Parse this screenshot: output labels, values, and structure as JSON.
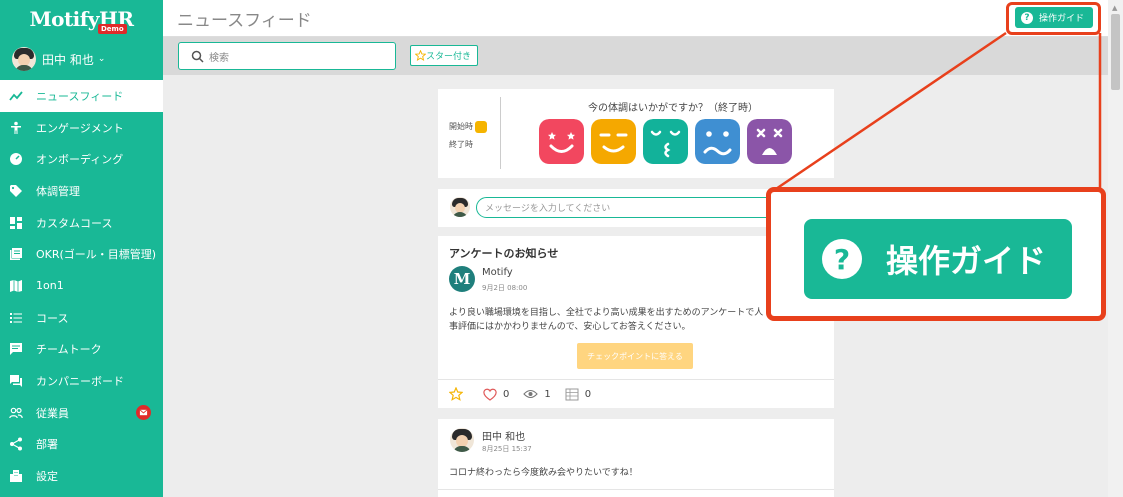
{
  "app": {
    "logo": "MotifyHR",
    "badge": "Demo"
  },
  "user": {
    "name": "田中 和也"
  },
  "sidebar": {
    "items": [
      {
        "label": "ニュースフィード",
        "icon": "trend-icon",
        "active": true
      },
      {
        "label": "エンゲージメント",
        "icon": "person-icon"
      },
      {
        "label": "オンボーディング",
        "icon": "gauge-icon"
      },
      {
        "label": "体調管理",
        "icon": "tag-icon"
      },
      {
        "label": "カスタムコース",
        "icon": "dashboard-icon"
      },
      {
        "label": "OKR(ゴール・目標管理)",
        "icon": "book-icon"
      },
      {
        "label": "1on1",
        "icon": "map-icon"
      },
      {
        "label": "コース",
        "icon": "list-icon"
      },
      {
        "label": "チームトーク",
        "icon": "chat-icon"
      },
      {
        "label": "カンパニーボード",
        "icon": "forum-icon"
      },
      {
        "label": "従業員",
        "icon": "people-icon",
        "badge": "mail-icon"
      },
      {
        "label": "部署",
        "icon": "share-icon"
      },
      {
        "label": "設定",
        "icon": "building-icon"
      }
    ]
  },
  "header": {
    "title": "ニュースフィード",
    "guide_label": "操作ガイド"
  },
  "search": {
    "placeholder": "検索",
    "star_filter": "スター付き"
  },
  "mood": {
    "question": "今の体調はいかがですか？（終了時）",
    "start_label": "開始時",
    "end_label": "終了時",
    "colors": [
      "#f2475f",
      "#f5a800",
      "#12b29a",
      "#3f8fd2",
      "#8b55a8"
    ]
  },
  "message": {
    "placeholder": "メッセージを入力してください"
  },
  "post": {
    "title": "アンケートのお知らせ",
    "author": "Motify",
    "date": "9月2日 08:00",
    "body": "より良い職場環境を目指し、全社でより高い成果を出すためのアンケートで人事評価にはかかわりませんので、安心してお答えください。",
    "cta": "チェックポイントに答える",
    "likes": "0",
    "views": "1",
    "comments": "0"
  },
  "post2": {
    "author": "田中 和也",
    "date": "8月25日 15:37",
    "body": "コロナ終わったら今度飲み会やりたいですね！"
  },
  "callout": {
    "label": "操作ガイド",
    "accent": "#e8401c",
    "brand": "#19b896"
  }
}
